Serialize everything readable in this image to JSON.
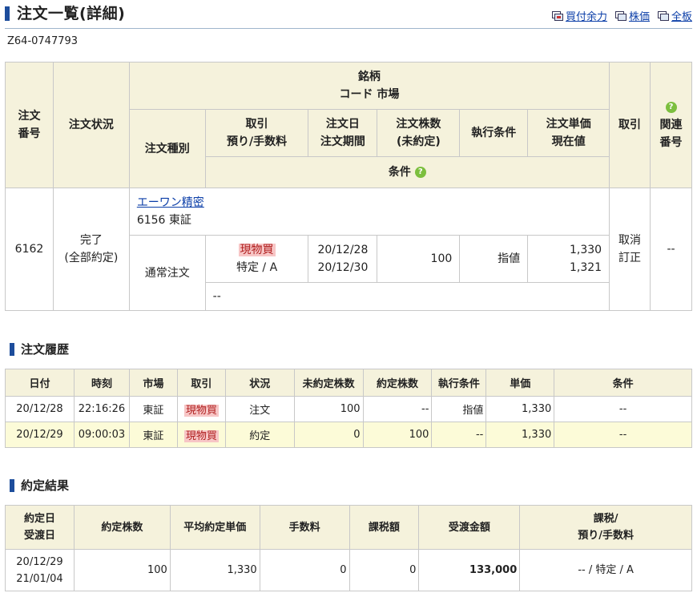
{
  "header": {
    "title": "注文一覧(詳細)",
    "links": [
      "買付余力",
      "株価",
      "全板"
    ]
  },
  "account_no": "Z64-0747793",
  "order_table": {
    "headers": {
      "order_no": "注文\n番号",
      "status": "注文状況",
      "brand": "銘柄",
      "code_market": "コード 市場",
      "order_type": "注文種別",
      "trade": "取引\n預り/手数料",
      "order_date": "注文日\n注文期間",
      "qty": "注文株数\n(未約定)",
      "exec_cond": "執行条件",
      "unit_price": "注文単価\n現在値",
      "action": "取引",
      "related": "関連\n番号",
      "condition": "条件"
    },
    "row": {
      "order_no": "6162",
      "status": "完了\n(全部約定)",
      "stock_name": "エーワン精密",
      "code_market": "6156 東証",
      "order_type": "通常注文",
      "trade_type": "現物買",
      "account_fee": "特定 / A",
      "order_date": "20/12/28",
      "period": "20/12/30",
      "qty": "100",
      "exec_cond": "指値",
      "unit_price": "1,330",
      "current_price": "1,321",
      "action": "取消\n訂正",
      "related": "--",
      "condition": "--"
    }
  },
  "history": {
    "title": "注文履歴",
    "columns": [
      "日付",
      "時刻",
      "市場",
      "取引",
      "状況",
      "未約定株数",
      "約定株数",
      "執行条件",
      "単価",
      "条件"
    ],
    "rows": [
      [
        "20/12/28",
        "22:16:26",
        "東証",
        "現物買",
        "注文",
        "100",
        "--",
        "指値",
        "1,330",
        "--"
      ],
      [
        "20/12/29",
        "09:00:03",
        "東証",
        "現物買",
        "約定",
        "0",
        "100",
        "--",
        "1,330",
        "--"
      ]
    ]
  },
  "results": {
    "title": "約定結果",
    "columns": [
      "約定日\n受渡日",
      "約定株数",
      "平均約定単価",
      "手数料",
      "課税額",
      "受渡金額",
      "課税/\n預り/手数料"
    ],
    "row": [
      "20/12/29\n21/01/04",
      "100",
      "1,330",
      "0",
      "0",
      "133,000",
      "-- / 特定 / A"
    ]
  },
  "colors": {
    "header_bg": "#f5f2dc",
    "link": "#0b3ea8",
    "buy_tag_bg": "#f7c6c6",
    "highlight_row": "#fcfbd8",
    "title_mark": "#1d4d9c"
  }
}
